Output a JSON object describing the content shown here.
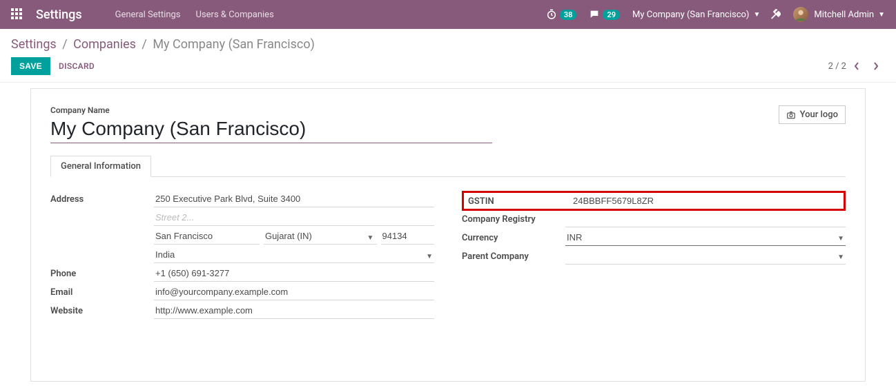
{
  "navbar": {
    "brand": "Settings",
    "links": [
      "General Settings",
      "Users & Companies"
    ],
    "timer_badge": "38",
    "chat_badge": "29",
    "company": "My Company (San Francisco)",
    "user": "Mitchell Admin"
  },
  "breadcrumb": {
    "root": "Settings",
    "mid": "Companies",
    "current": "My Company (San Francisco)"
  },
  "buttons": {
    "save": "SAVE",
    "discard": "DISCARD",
    "logo": "Your logo"
  },
  "pager": "2 / 2",
  "form": {
    "company_name_label": "Company Name",
    "company_name": "My Company (San Francisco)",
    "tab": "General Information",
    "labels": {
      "address": "Address",
      "phone": "Phone",
      "email": "Email",
      "website": "Website",
      "gstin": "GSTIN",
      "company_registry": "Company Registry",
      "currency": "Currency",
      "parent_company": "Parent Company"
    },
    "address": {
      "street": "250 Executive Park Blvd, Suite 3400",
      "street2_placeholder": "Street 2...",
      "city": "San Francisco",
      "state": "Gujarat (IN)",
      "zip": "94134",
      "country": "India"
    },
    "phone": "+1 (650) 691-3277",
    "email": "info@yourcompany.example.com",
    "website": "http://www.example.com",
    "gstin": "24BBBFF5679L8ZR",
    "company_registry": "",
    "currency": "INR",
    "parent_company": ""
  }
}
